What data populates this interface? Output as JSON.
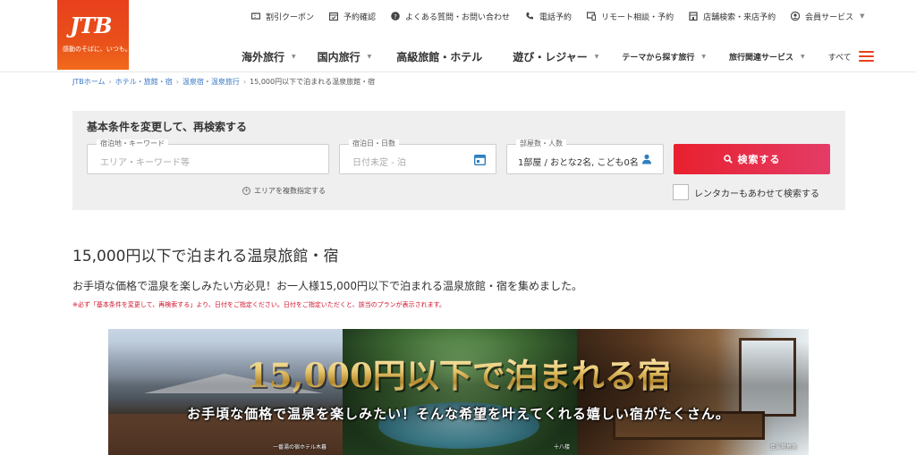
{
  "logo": {
    "mark": "JTB",
    "tagline": "感動のそばに、いつも。"
  },
  "util_nav": [
    {
      "label": "割引クーポン",
      "icon": "coupon-icon"
    },
    {
      "label": "予約確認",
      "icon": "calendar-check-icon"
    },
    {
      "label": "よくある質問・お問い合わせ",
      "icon": "question-icon"
    },
    {
      "label": "電話予約",
      "icon": "phone-icon"
    },
    {
      "label": "リモート相談・予約",
      "icon": "remote-icon"
    },
    {
      "label": "店舗検索・来店予約",
      "icon": "store-icon"
    },
    {
      "label": "会員サービス",
      "icon": "user-icon"
    }
  ],
  "main_nav": [
    {
      "label": "海外旅行"
    },
    {
      "label": "国内旅行"
    },
    {
      "label": "高級旅館・ホテル"
    },
    {
      "label": "遊び・レジャー"
    },
    {
      "label": "テーマから探す旅行"
    },
    {
      "label": "旅行関連サービス"
    },
    {
      "label": "すべて"
    }
  ],
  "breadcrumb": [
    "JTBホーム",
    "ホテル・旅館・宿",
    "温泉宿・温泉旅行",
    "15,000円以下で泊まれる温泉旅館・宿"
  ],
  "search": {
    "title": "基本条件を変更して、再検索する",
    "area_label": "宿泊地・キーワード",
    "area_placeholder": "エリア・キーワード等",
    "date_label": "宿泊日・日数",
    "date_placeholder": "日付未定 - 泊",
    "guests_label": "部屋数・人数",
    "guests_value": "1部屋 / おとな2名, こども0名",
    "multi_area": "エリアを複数指定する",
    "button": "検索する",
    "rental_car": "レンタカーもあわせて検索する"
  },
  "content": {
    "title": "15,000円以下で泊まれる温泉旅館・宿",
    "description": "お手頃な価格で温泉を楽しみたい方必見！お一人様15,000円以下で泊まれる温泉旅館・宿を集めました。",
    "note": "※必ず「基本条件を変更して、再検索する」より、日付をご指定ください。日付をご指定いただくと、該当のプランが表示されます。"
  },
  "banner": {
    "headline": "15,000円以下で泊まれる宿",
    "subline": "お手頃な価格で温泉を楽しみたい！そんな希望を叶えてくれる嬉しい宿がたくさん。",
    "captions": [
      "一番湯の宿ホテル木暮",
      "十八楼",
      "佳翠苑皆美"
    ]
  },
  "colors": {
    "brand": "#e8401c",
    "search_button": "#e8202e",
    "link": "#3a79c4",
    "note": "#d0102a"
  }
}
